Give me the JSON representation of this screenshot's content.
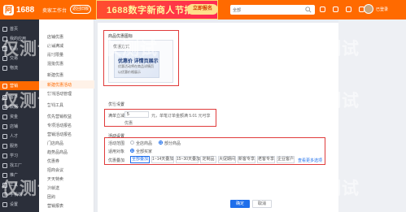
{
  "topbar": {
    "logo_mark": "阿",
    "logo_text": "1688",
    "workspace": "卖家工作台",
    "old_version": "返回旧版",
    "banner_title": "1688数字新商人节招商",
    "banner_button": "立即报名",
    "search_scope": "全部",
    "user_name": "已登录"
  },
  "sidebar": {
    "items": [
      {
        "label": "首页"
      },
      {
        "label": "我的应用"
      },
      {
        "label": "商品"
      },
      {
        "label": "交易"
      },
      {
        "label": "物流"
      },
      {
        "label": "营销"
      },
      {
        "label": "客户"
      },
      {
        "label": "数据"
      },
      {
        "label": "资金"
      },
      {
        "label": "店铺"
      },
      {
        "label": "人才"
      },
      {
        "label": "服务"
      },
      {
        "label": "学习"
      },
      {
        "label": "找工厂"
      },
      {
        "label": "推广"
      },
      {
        "label": "工具"
      },
      {
        "label": "手机端"
      },
      {
        "label": "设置"
      },
      {
        "label": "帮助"
      },
      {
        "label": "更多"
      }
    ]
  },
  "submenu": {
    "items": [
      {
        "label": "店铺优惠"
      },
      {
        "label": "店铺满减"
      },
      {
        "label": "限时限量"
      },
      {
        "label": "混批优惠"
      },
      {
        "label": "新建优惠"
      },
      {
        "label": "新建优惠活动"
      },
      {
        "label": "营销活动管理"
      },
      {
        "label": "营销工具"
      },
      {
        "label": "优先营销权益"
      },
      {
        "label": "专项活动报名"
      },
      {
        "label": "营销活动报名"
      },
      {
        "label": "门店商品"
      },
      {
        "label": "趋势品商品"
      },
      {
        "label": "优惠券"
      },
      {
        "label": "招商会议"
      },
      {
        "label": "天天特卖"
      },
      {
        "label": "满就送"
      },
      {
        "label": "团购"
      },
      {
        "label": "营销报表"
      },
      {
        "label": "营销工具管理"
      }
    ],
    "active_index": 5
  },
  "form": {
    "section1_title": "商品优惠图标",
    "image_card_label": "优惠方式",
    "image_line1": "优惠价 详情页展示",
    "image_line2": "优惠活动将在商品详情页",
    "image_line3": "以优惠价格展示",
    "section2_title": "优惠设置",
    "threshold_label": "满单立减",
    "threshold_value": "5",
    "threshold_hint": "元，单笔订单金额满 5.01 元可享",
    "threshold_hint2": "优惠",
    "section3_title": "活动设置",
    "opt_row1_label": "活动范围",
    "opt_row1_a": "全店商品",
    "opt_row1_b": "部分商品",
    "opt_row2_label": "适用对象",
    "opt_row2_a": "全部买家",
    "opt_row3_label": "优惠叠加",
    "segments": [
      "全部叠加",
      "1~14天叠加",
      "15~30天叠加",
      "定制品",
      "大促期间",
      "新客专享",
      "老客专享",
      "企业客户"
    ],
    "more_link": "查看更多选项",
    "btn_confirm": "确定",
    "btn_cancel": "取消"
  },
  "watermark": "仅测试"
}
